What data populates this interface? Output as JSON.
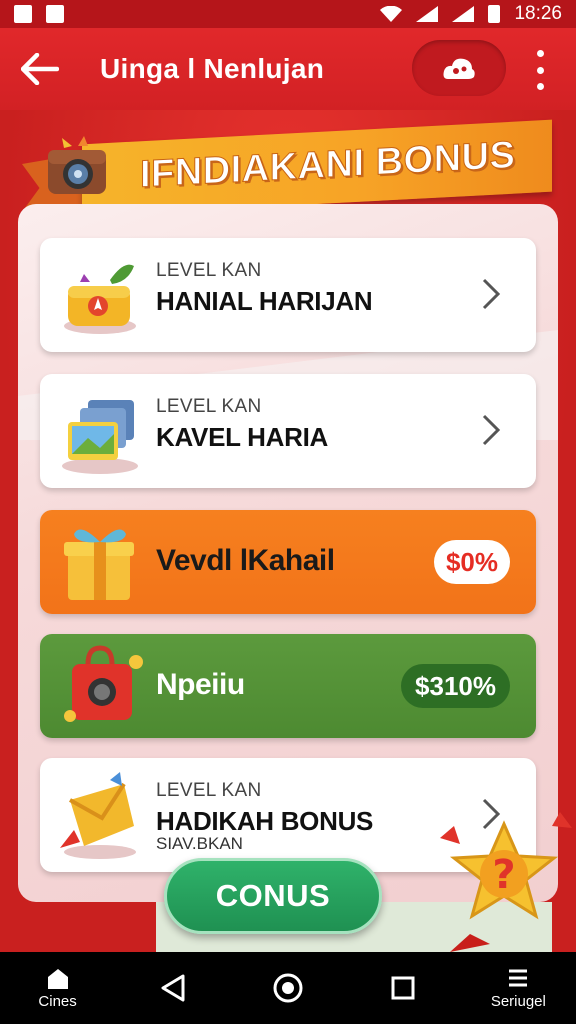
{
  "status_bar": {
    "time": "18:26"
  },
  "app_bar": {
    "title": "Uinga l Nenlujan"
  },
  "banner": {
    "title": "IFNDIAKANI BONUS"
  },
  "cards": [
    {
      "subtitle": "LEVEL KAN",
      "title": "HANIAL HARIJAN"
    },
    {
      "subtitle": "LEVEL KAN",
      "title": "KAVEL HARIA"
    },
    {
      "title": "Vevdl lKahail",
      "badge": "$0%"
    },
    {
      "title": "Npeiiu",
      "badge": "$310%"
    },
    {
      "subtitle": "LEVEL KAN",
      "title": "HADIKAH BONUS",
      "footnote": "SIAV.BKAN"
    }
  ],
  "cta": {
    "label": "CONUS"
  },
  "nav": {
    "left_label": "Cines",
    "right_label": "Seriugel"
  },
  "colors": {
    "primary_red": "#d22124",
    "orange": "#f6801f",
    "green": "#5c9a3d",
    "cta_green": "#2fb26a"
  }
}
